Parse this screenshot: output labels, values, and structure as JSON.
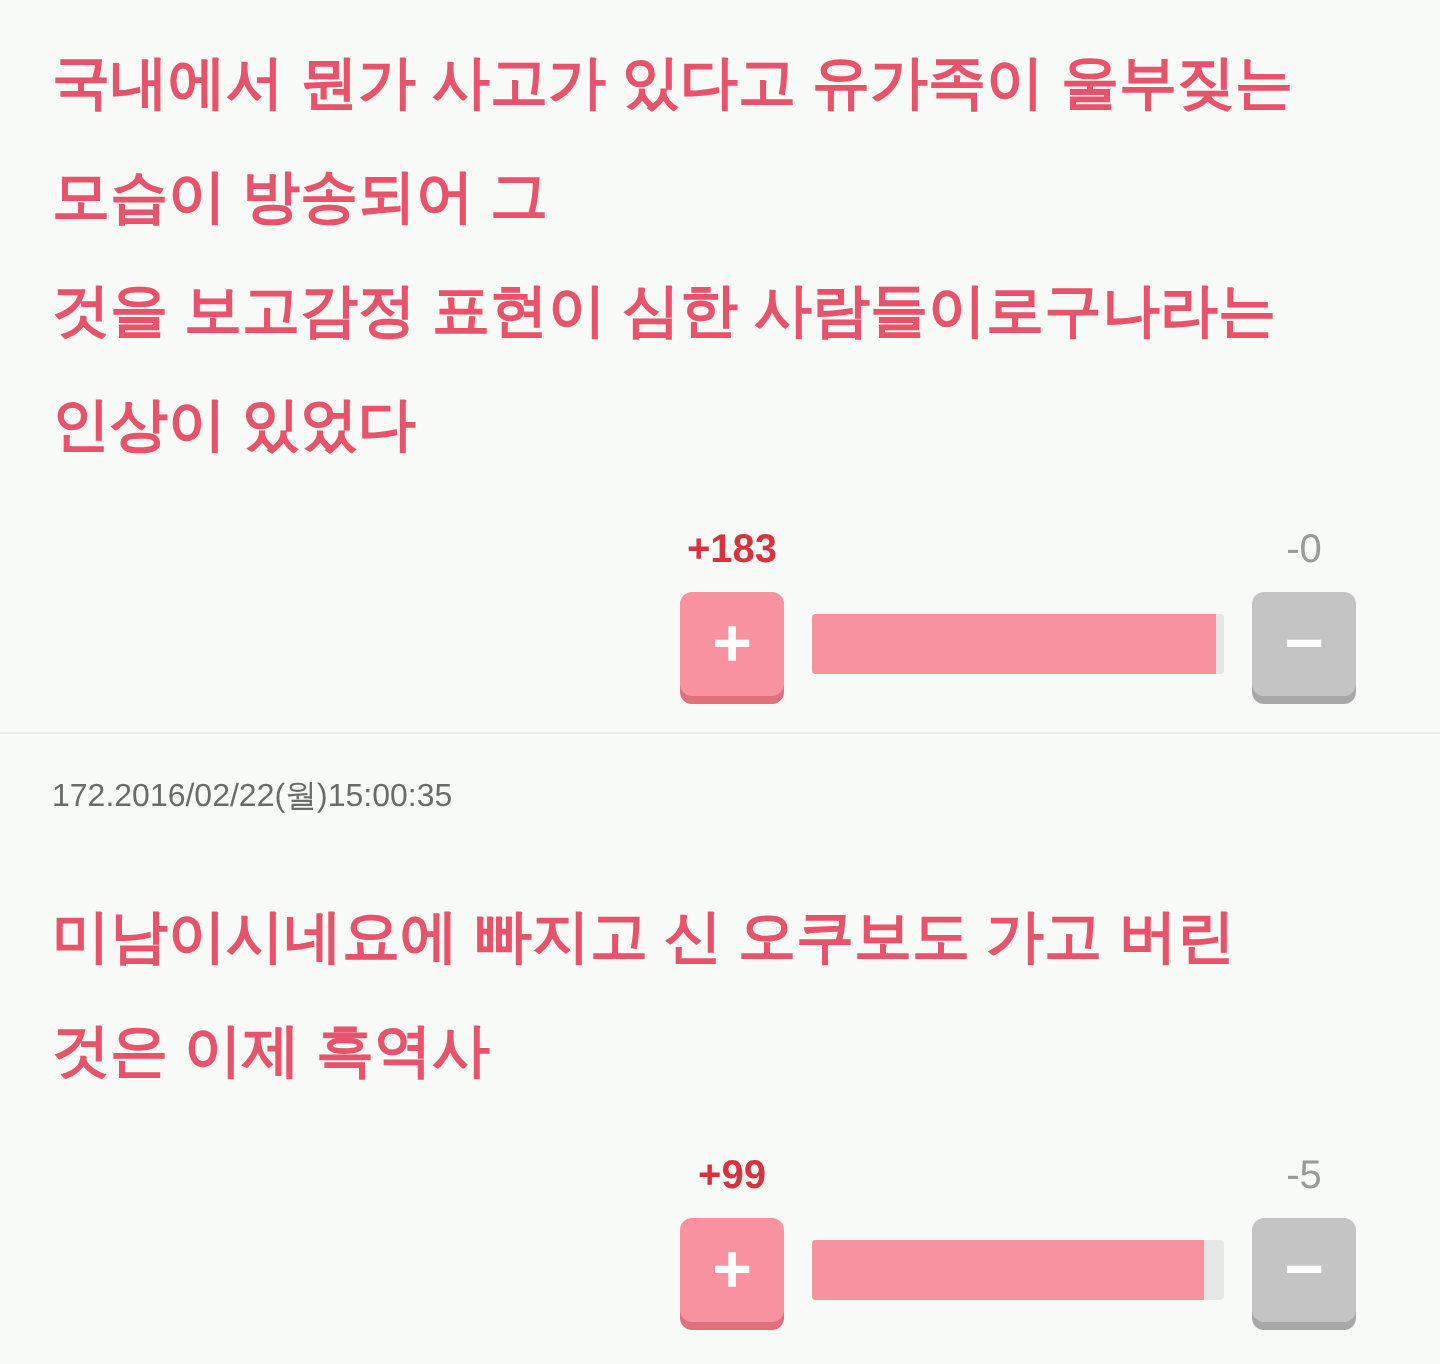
{
  "comments": [
    {
      "text": "국내에서 뭔가 사고가 있다고 유가족이 울부짖는\n모습이 방송되어 그\n것을 보고감정 표현이 심한 사람들이로구나라는\n인상이 있었다",
      "votes": {
        "up": "+183",
        "down": "-0",
        "up_symbol": "+",
        "down_symbol": "−",
        "level": 0.98
      }
    },
    {
      "meta": "172.2016/02/22(월)15:00:35",
      "text": "미남이시네요에 빠지고 신 오쿠보도 가고 버린\n것은 이제 흑역사",
      "votes": {
        "up": "+99",
        "down": "-5",
        "up_symbol": "+",
        "down_symbol": "−",
        "level": 0.95
      }
    }
  ]
}
